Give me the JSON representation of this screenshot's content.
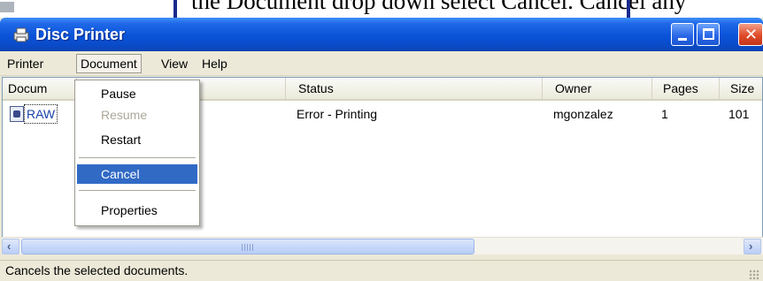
{
  "document_text": "the Document drop down select Cancel. Cancel any",
  "window": {
    "title": "Disc Printer",
    "controls": {
      "minimize": "minimize",
      "maximize": "maximize",
      "close": "close"
    }
  },
  "menubar": {
    "items": [
      "Printer",
      "Document",
      "View",
      "Help"
    ],
    "active": "Document"
  },
  "dropdown": {
    "items": [
      {
        "label": "Pause",
        "enabled": true
      },
      {
        "label": "Resume",
        "enabled": false
      },
      {
        "label": "Restart",
        "enabled": true
      },
      {
        "label": "Cancel",
        "enabled": true,
        "highlighted": true
      },
      {
        "label": "Properties",
        "enabled": true
      }
    ]
  },
  "table": {
    "columns": [
      "Docum",
      "Status",
      "Owner",
      "Pages",
      "Size"
    ],
    "rows": [
      {
        "document": "RAW",
        "status": "Error - Printing",
        "owner": "mgonzalez",
        "pages": "1",
        "size": "101"
      }
    ]
  },
  "scrollbar": {
    "left_glyph": "‹",
    "right_glyph": "›"
  },
  "statusbar": {
    "text": "Cancels the selected documents."
  },
  "colors": {
    "titlebar": "#0a53d8",
    "selection": "#316ac5",
    "window_bg": "#ece9d8"
  },
  "icons": [
    "printer-icon",
    "document-icon",
    "minimize-icon",
    "maximize-icon",
    "close-icon",
    "scroll-left-icon",
    "scroll-right-icon"
  ]
}
